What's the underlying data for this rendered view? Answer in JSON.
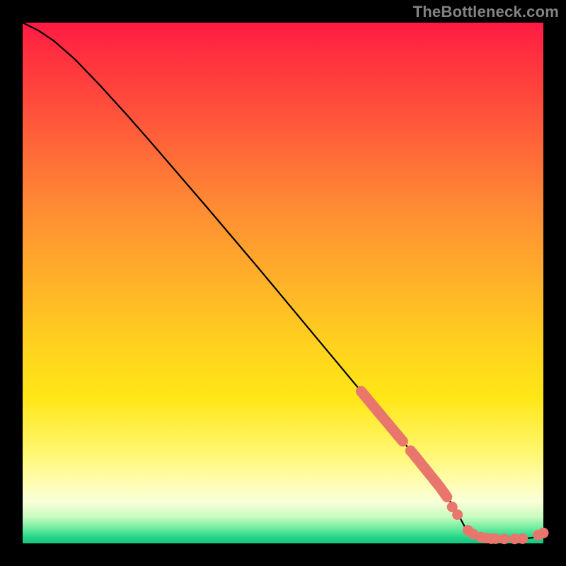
{
  "attribution": "TheBottleneck.com",
  "colors": {
    "dot": "#e9766c",
    "line": "#000000"
  },
  "chart_data": {
    "type": "line",
    "title": "",
    "xlabel": "",
    "ylabel": "",
    "xlim": [
      0,
      100
    ],
    "ylim": [
      0,
      100
    ],
    "grid": false,
    "legend": false,
    "series": [
      {
        "name": "curve",
        "x": [
          0,
          3,
          6,
          10,
          15,
          20,
          25,
          30,
          35,
          40,
          45,
          50,
          55,
          60,
          65,
          70,
          75,
          80,
          83,
          85,
          88,
          90,
          92,
          94,
          96,
          98,
          100
        ],
        "y": [
          100,
          98.5,
          96.5,
          93,
          87.8,
          82.3,
          76.6,
          70.8,
          65,
          59.1,
          53.2,
          47.2,
          41.2,
          35.2,
          29.2,
          23.2,
          17.2,
          11,
          6.8,
          3,
          1.2,
          0.9,
          0.8,
          0.8,
          0.85,
          1.1,
          2.0
        ]
      }
    ],
    "points_on_curve": {
      "comment": "salmon dots/pills overlaid on the curve near the bottom-right",
      "clusters": [
        {
          "x_range": [
            65,
            73
          ],
          "shape": "thick-segment",
          "y_approx": [
            29,
            19
          ]
        },
        {
          "x_range": [
            74.5,
            81.5
          ],
          "shape": "thick-segment",
          "y_approx": [
            17,
            9
          ]
        },
        {
          "x": 82.5,
          "y": 7.0,
          "shape": "dot"
        },
        {
          "x": 83.5,
          "y": 5.5,
          "shape": "dot"
        },
        {
          "x": 85.5,
          "y": 2.5,
          "shape": "dot"
        },
        {
          "x": 86.5,
          "y": 1.8,
          "shape": "dot"
        },
        {
          "x": 88.0,
          "y": 1.2,
          "shape": "dot"
        },
        {
          "x": 89.0,
          "y": 1.0,
          "shape": "dot"
        },
        {
          "x": 90.0,
          "y": 0.9,
          "shape": "dot"
        },
        {
          "x": 90.8,
          "y": 0.9,
          "shape": "dot"
        },
        {
          "x": 92.5,
          "y": 0.85,
          "shape": "dot"
        },
        {
          "x": 94.5,
          "y": 0.85,
          "shape": "dot"
        },
        {
          "x": 96.0,
          "y": 0.9,
          "shape": "dot"
        },
        {
          "x": 99.0,
          "y": 1.6,
          "shape": "dot"
        },
        {
          "x": 100.0,
          "y": 2.0,
          "shape": "dot"
        }
      ]
    }
  }
}
